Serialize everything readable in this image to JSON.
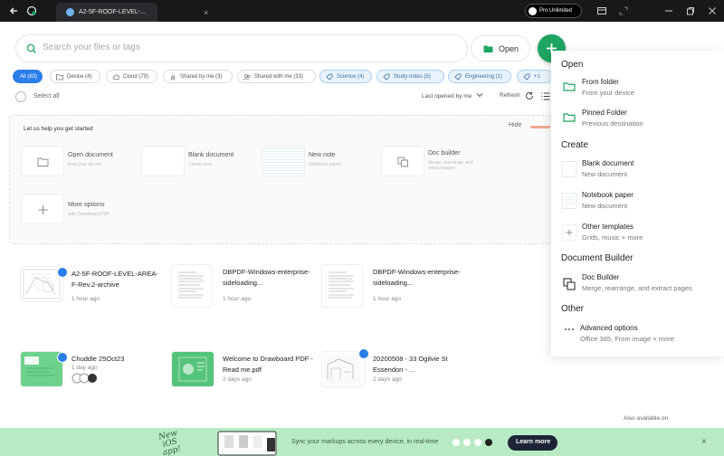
{
  "titlebar": {
    "tab_title": "A2-5F-ROOF-LEVEL-...",
    "tab_close": "×",
    "plan_badge": "Pro Unlimited"
  },
  "search": {
    "placeholder": "Search your files or tags"
  },
  "open_button": {
    "label": "Open"
  },
  "filters": [
    {
      "label": "All (83)",
      "icon": "none",
      "state": "active"
    },
    {
      "label": "Device (4)",
      "icon": "folder-icon"
    },
    {
      "label": "Cloud (79)",
      "icon": "cloud-icon"
    },
    {
      "label": "Shared by me (3)",
      "icon": "hand-icon"
    },
    {
      "label": "Shared with me (33)",
      "icon": "people-icon"
    },
    {
      "label": "Science (4)",
      "icon": "tag-icon",
      "state": "tag"
    },
    {
      "label": "Study notes (5)",
      "icon": "tag-icon",
      "state": "tag"
    },
    {
      "label": "Engineering (1)",
      "icon": "tag-icon",
      "state": "tag"
    },
    {
      "label": "+1",
      "icon": "tag-icon",
      "state": "tag"
    }
  ],
  "toolbar": {
    "select_all": "Select all",
    "sort": "Last opened by me",
    "refresh": "Refresh"
  },
  "getting_started": {
    "title": "Let us help you get started",
    "hide": "Hide",
    "tiles": [
      {
        "name": "Open document",
        "sub": "from your device",
        "icon": "folder-icon"
      },
      {
        "name": "Blank document",
        "sub": "Create new",
        "icon": "none"
      },
      {
        "name": "New note",
        "sub": "Notebook paper",
        "icon": "none"
      },
      {
        "name": "Doc builder",
        "sub": "Merge, rearrange, and extract pages",
        "icon": "copy-icon"
      },
      {
        "name": "More options",
        "sub": "with Drawboard PDF",
        "icon": "plus-icon"
      }
    ]
  },
  "files": [
    {
      "name": "A2-5F-ROOF-LEVEL-AREA-F-Rev.2-archive",
      "date": "1 hour ago",
      "thumb": "drawing"
    },
    {
      "name": "DBPDF-Windows-enterprise-sideloading...",
      "date": "1 hour ago",
      "thumb": "document"
    },
    {
      "name": "DBPDF-Windows-enterprise-sideloading...",
      "date": "1 hour ago",
      "thumb": "document"
    },
    {
      "name": "Chuddle 25Oct23",
      "date": "1 day ago",
      "thumb": "green"
    },
    {
      "name": "Welcome to Drawboard PDF - Read me.pdf",
      "date": "2 days ago",
      "thumb": "green-grid"
    },
    {
      "name": "20200508 - 33 Ogilvie St Essendon - ...",
      "date": "2 days ago",
      "thumb": "architecture"
    }
  ],
  "dropdown": {
    "sections": [
      {
        "heading": "Open",
        "items": [
          {
            "label": "From folder",
            "sub": "From your device",
            "icon": "folder-open-icon"
          },
          {
            "label": "Pinned Folder",
            "sub": "Previous destination",
            "icon": "folder-open-icon"
          }
        ]
      },
      {
        "heading": "Create",
        "items": [
          {
            "label": "Blank document",
            "sub": "New document",
            "icon": "blank-page-icon"
          },
          {
            "label": "Notebook paper",
            "sub": "New document",
            "icon": "lined-page-icon"
          },
          {
            "label": "Other templates",
            "sub": "Grids, music + more",
            "icon": "plus-icon"
          }
        ]
      },
      {
        "heading": "Document Builder",
        "items": [
          {
            "label": "Doc Builder",
            "sub": "Merge, rearrange, and extract pages",
            "icon": "copy-icon"
          }
        ]
      },
      {
        "heading": "Other",
        "items": [
          {
            "label": "Advanced options",
            "sub": "Office 365, From image + more",
            "icon": "more-icon"
          }
        ]
      }
    ]
  },
  "availability": "Also available on",
  "banner": {
    "new_ios": "New iOS app!",
    "text": "Sync your markups across every device, in real-time",
    "button": "Learn more",
    "close": "×"
  },
  "colors": {
    "accent_green": "#1ea562",
    "accent_blue": "#2b7de9",
    "banner_bg": "#b8ebc5"
  }
}
